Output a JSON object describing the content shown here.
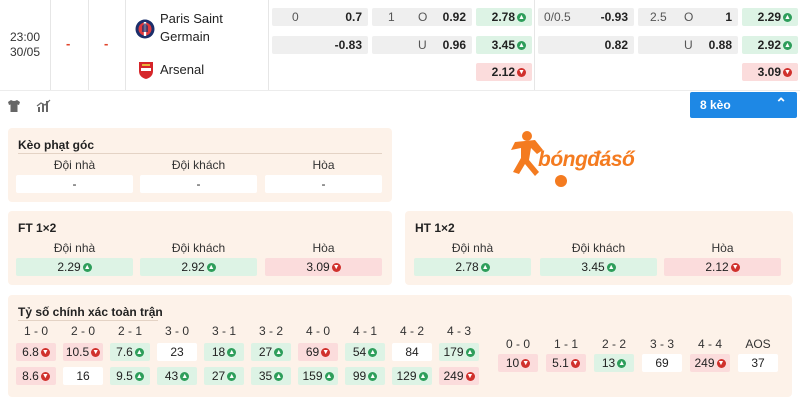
{
  "match": {
    "time": "23:00",
    "date": "30/05",
    "dash1": "-",
    "dash2": "-",
    "home": {
      "name_line1": "Paris Saint",
      "name_line2": "Germain"
    },
    "away": {
      "name": "Arsenal"
    }
  },
  "odds": {
    "ft": {
      "row1": {
        "hcap_line": "0",
        "hcap_val": "0.7",
        "ou_line": "1",
        "ou_tag": "O",
        "ou_val": "0.92",
        "x12_val": "2.78"
      },
      "row2": {
        "hcap_val": "-0.83",
        "ou_tag": "U",
        "ou_val": "0.96",
        "x12_val": "3.45"
      },
      "row3": {
        "x12_val": "2.12"
      }
    },
    "ht": {
      "row1": {
        "hcap_line": "0/0.5",
        "hcap_val": "-0.93",
        "ou_line": "2.5",
        "ou_tag": "O",
        "ou_val": "1",
        "x12_val": "2.29"
      },
      "row2": {
        "hcap_val": "0.82",
        "ou_tag": "U",
        "ou_val": "0.88",
        "x12_val": "2.92"
      },
      "row3": {
        "x12_val": "3.09"
      }
    }
  },
  "toolbar": {
    "keo_label": "8 kèo",
    "keo_chevron": "⌃"
  },
  "corner": {
    "title": "Kèo phạt góc",
    "headers": [
      "Đội nhà",
      "Đội khách",
      "Hòa"
    ],
    "values": [
      "-",
      "-",
      "-"
    ]
  },
  "ft12": {
    "title": "FT 1×2",
    "headers": [
      "Đội nhà",
      "Đội khách",
      "Hòa"
    ],
    "values": [
      "2.29",
      "2.92",
      "3.09"
    ]
  },
  "ht12": {
    "title": "HT 1×2",
    "headers": [
      "Đội nhà",
      "Đội khách",
      "Hòa"
    ],
    "values": [
      "2.78",
      "3.45",
      "2.12"
    ]
  },
  "logo": {
    "text": "bóngđáső"
  },
  "correct_score": {
    "title": "Tỷ số chính xác toàn trận",
    "left_headers": [
      "1 - 0",
      "2 - 0",
      "2 - 1",
      "3 - 0",
      "3 - 1",
      "3 - 2",
      "4 - 0",
      "4 - 1",
      "4 - 2",
      "4 - 3"
    ],
    "left_row1": [
      "6.8",
      "10.5",
      "7.6",
      "23",
      "18",
      "27",
      "69",
      "54",
      "84",
      "179"
    ],
    "left_row2": [
      "8.6",
      "16",
      "9.5",
      "43",
      "27",
      "35",
      "159",
      "99",
      "129",
      "249"
    ],
    "right_headers": [
      "0 - 0",
      "1 - 1",
      "2 - 2",
      "3 - 3",
      "4 - 4",
      "AOS"
    ],
    "right_row1": [
      "10",
      "5.1",
      "13",
      "69",
      "249",
      "37"
    ]
  },
  "colors": {
    "up": "#2e9e5b",
    "down": "#d0312d",
    "accent": "#1e88e5",
    "panel": "#fdf2e9",
    "brand": "#f47b20"
  }
}
